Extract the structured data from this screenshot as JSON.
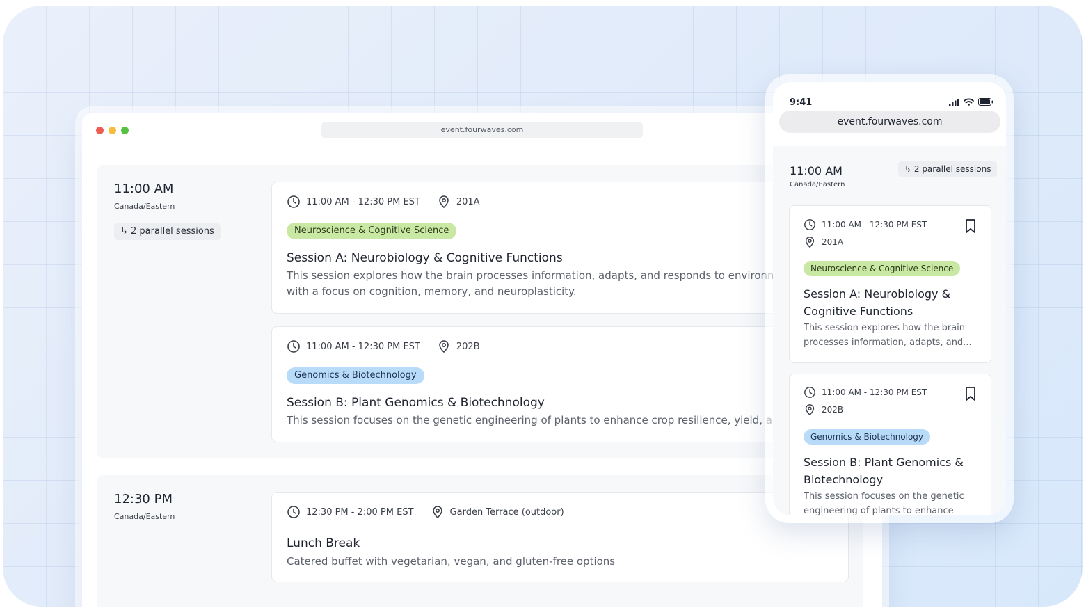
{
  "desktop": {
    "url": "event.fourwaves.com",
    "blocks": [
      {
        "time": "11:00 AM",
        "zone": "Canada/Eastern",
        "parallel": "↳ 2 parallel sessions",
        "sessions": [
          {
            "time_range": "11:00 AM - 12:30 PM EST",
            "room": "201A",
            "tag": "Neuroscience & Cognitive Science",
            "title": "Session A: Neurobiology & Cognitive Functions",
            "desc": "This session explores how the brain processes information, adapts, and responds to environmental factors, with a focus on cognition, memory, and neuroplasticity."
          },
          {
            "time_range": "11:00 AM - 12:30 PM EST",
            "room": "202B",
            "tag": "Genomics & Biotechnology",
            "title": "Session B: Plant Genomics & Biotechnology",
            "desc": "This session focuses on the genetic engineering of plants to enhance crop resilience, yield, and adaptability."
          }
        ]
      },
      {
        "time": "12:30 PM",
        "zone": "Canada/Eastern",
        "sessions": [
          {
            "time_range": "12:30 PM - 2:00 PM EST",
            "room": "Garden Terrace (outdoor)",
            "title": "Lunch Break",
            "desc": "Catered buffet with vegetarian, vegan, and gluten-free options"
          }
        ]
      }
    ]
  },
  "phone": {
    "clock": "9:41",
    "url": "event.fourwaves.com",
    "time": "11:00 AM",
    "zone": "Canada/Eastern",
    "parallel": "↳ 2 parallel sessions",
    "sessions": [
      {
        "time_range": "11:00 AM - 12:30 PM EST",
        "room": "201A",
        "tag": "Neuroscience & Cognitive Science",
        "title": "Session A: Neurobiology & Cognitive Functions",
        "desc": "This session explores how the brain processes information, adapts, and..."
      },
      {
        "time_range": "11:00 AM - 12:30 PM EST",
        "room": "202B",
        "tag": "Genomics & Biotechnology",
        "title": "Session B: Plant Genomics & Biotechnology",
        "desc": "This session focuses on the genetic engineering of plants to enhance cro..."
      }
    ]
  },
  "colors": {
    "tag_green": "#c9e8a4",
    "tag_blue": "#b9dbfa",
    "dot_red": "#ee5c54",
    "dot_yellow": "#f3bd3d",
    "dot_green": "#58c043"
  },
  "icons": [
    "clock-icon",
    "location-pin-icon",
    "bookmark-icon",
    "signal-icon",
    "wifi-icon",
    "battery-icon"
  ]
}
